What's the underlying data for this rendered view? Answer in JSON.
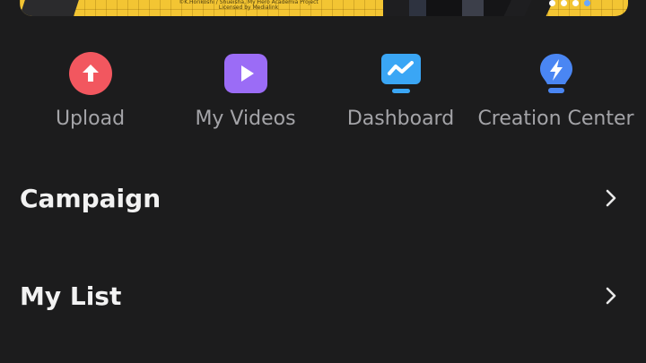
{
  "banner": {
    "caption": "©K.Horikoshi / Shueisha, My Hero Academia Project Licensed by Medialink",
    "page_dots": 4,
    "active_dot_index": 3
  },
  "quick_actions": [
    {
      "label": "Upload",
      "icon": "upload-icon",
      "color": "#f2575f"
    },
    {
      "label": "My Videos",
      "icon": "play-icon",
      "color": "#9b6cf6"
    },
    {
      "label": "Dashboard",
      "icon": "dashboard-icon",
      "color": "#3aa6f5"
    },
    {
      "label": "Creation Center",
      "icon": "lightbulb-icon",
      "color": "#4a86f3"
    }
  ],
  "menu": [
    {
      "label": "Campaign"
    },
    {
      "label": "My List"
    }
  ]
}
